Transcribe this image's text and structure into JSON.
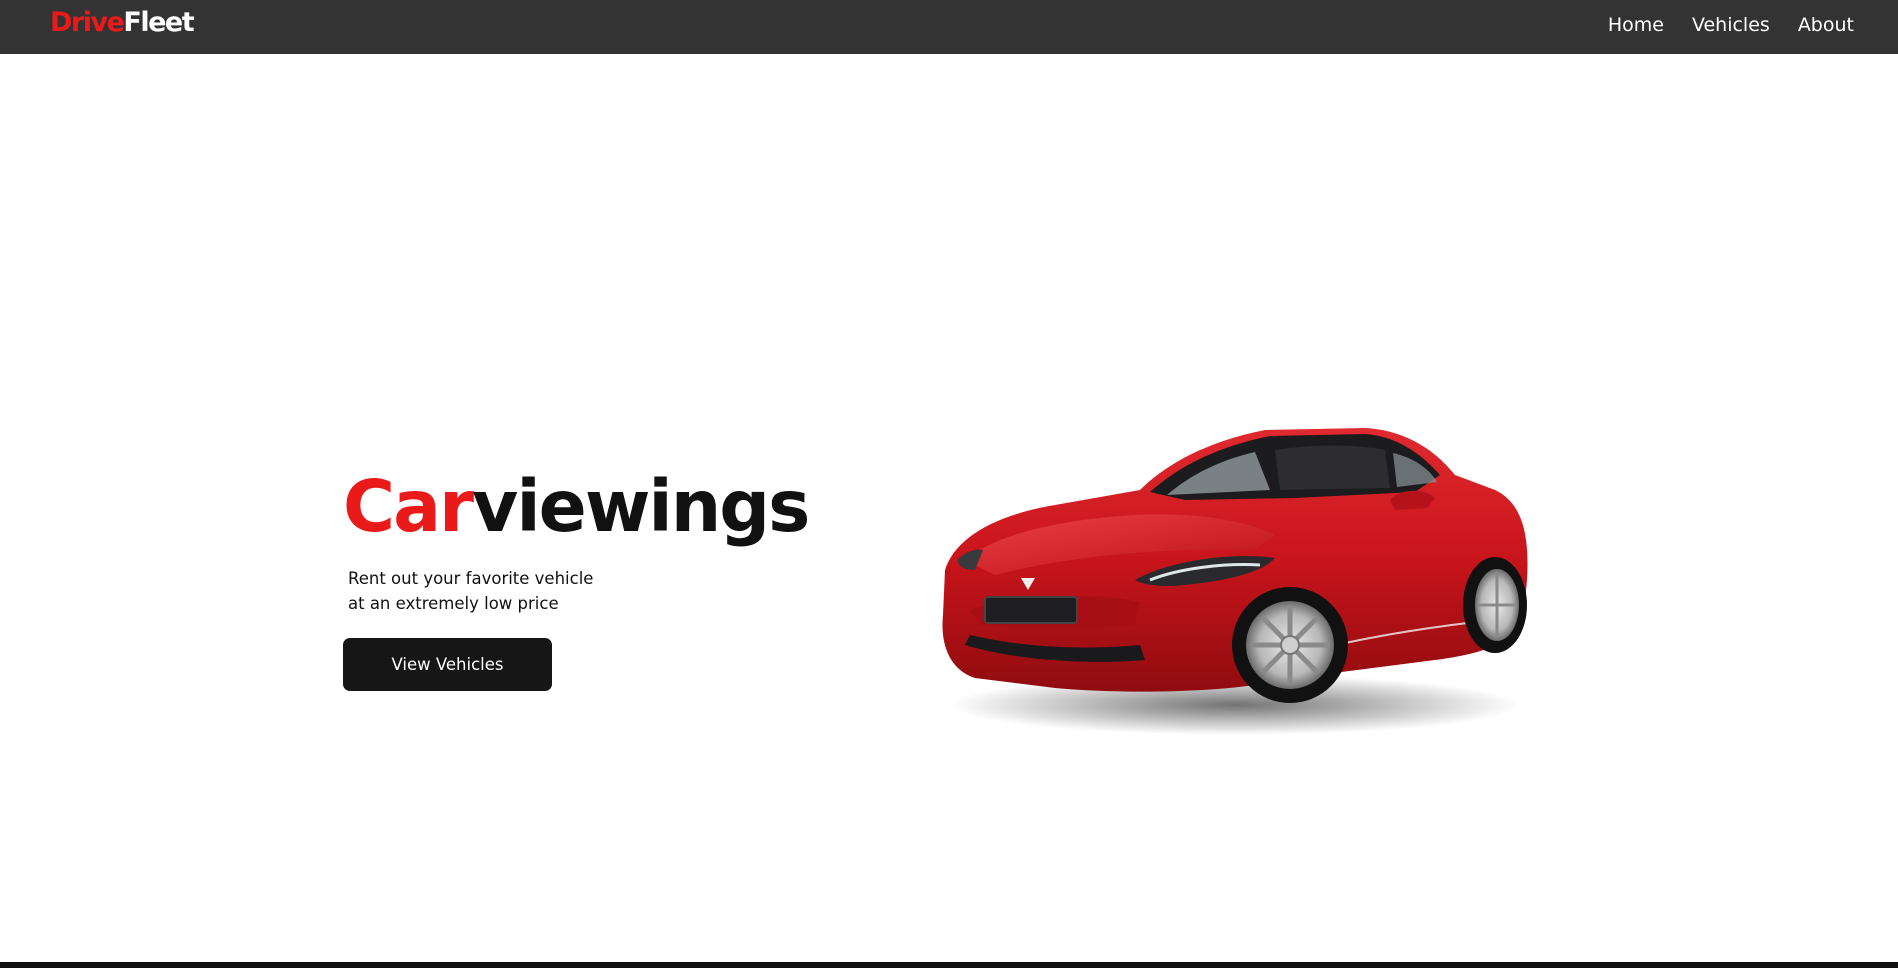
{
  "brand": {
    "part1": "Drive",
    "part2": "Fleet",
    "accent_color": "#ea1a1a"
  },
  "nav": {
    "links": [
      {
        "label": "Home"
      },
      {
        "label": "Vehicles"
      },
      {
        "label": "About"
      }
    ],
    "background": "#333333"
  },
  "hero": {
    "title_accent": "Car",
    "title_rest": "viewings",
    "subtitle_line1": "Rent out your favorite vehicle",
    "subtitle_line2": "at an extremely low price",
    "cta_label": "View Vehicles",
    "image": "red-sports-car-image"
  }
}
